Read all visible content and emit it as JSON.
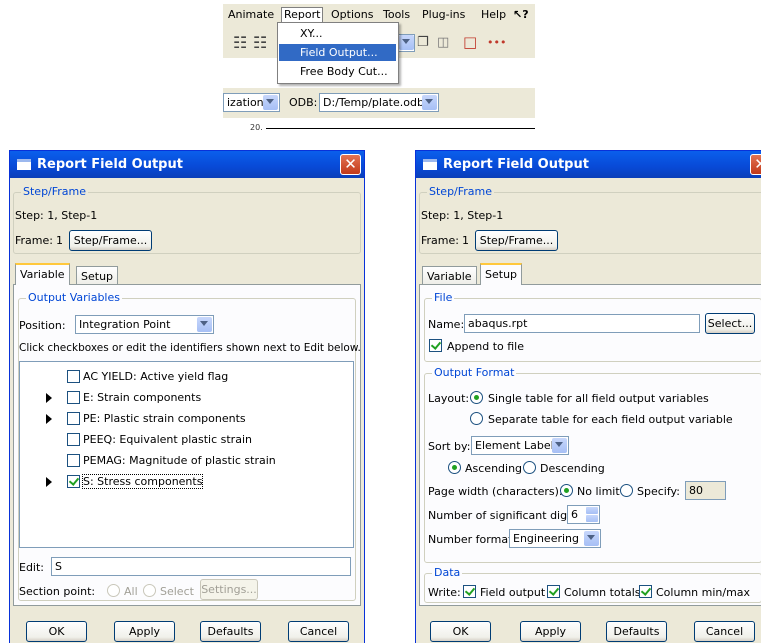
{
  "menubar": {
    "items": [
      "Animate",
      "Report",
      "Options",
      "Tools",
      "Plug-ins",
      "Help",
      "↖?"
    ],
    "active": "Report"
  },
  "report_menu": {
    "items": [
      "XY...",
      "Field Output...",
      "Free Body Cut..."
    ],
    "highlighted": "Field Output..."
  },
  "context_bar": {
    "module_combo_value": "ization",
    "odb_label": "ODB:",
    "odb_value": "D:/Temp/plate.odb"
  },
  "plot_tick_label": "20.",
  "colors": {
    "title_bar": "#0a5fec",
    "selection": "#316ac5",
    "group_title": "#0046d5",
    "dialog_bg": "#ece9d8"
  },
  "dialog_left": {
    "title": "Report Field Output",
    "step_frame_group": "Step/Frame",
    "step_text": "Step: 1, Step-1",
    "frame_label": "Frame:",
    "frame_value": "1",
    "step_frame_button": "Step/Frame...",
    "tabs": [
      "Variable",
      "Setup"
    ],
    "active_tab": "Variable",
    "output_variables_group": "Output Variables",
    "position_label": "Position:",
    "position_value": "Integration Point",
    "instructions": "Click checkboxes or edit the identifiers shown next to Edit below.",
    "variables": [
      {
        "label": "AC YIELD: Active yield flag",
        "checked": false,
        "expandable": false
      },
      {
        "label": "E: Strain components",
        "checked": false,
        "expandable": true
      },
      {
        "label": "PE: Plastic strain components",
        "checked": false,
        "expandable": true
      },
      {
        "label": "PEEQ: Equivalent plastic strain",
        "checked": false,
        "expandable": false
      },
      {
        "label": "PEMAG: Magnitude of plastic strain",
        "checked": false,
        "expandable": false
      },
      {
        "label": "S: Stress components",
        "checked": true,
        "expandable": true
      }
    ],
    "edit_label": "Edit:",
    "edit_value": "S",
    "section_point_label": "Section point:",
    "section_all": "All",
    "section_select": "Select",
    "settings_button": "Settings...",
    "buttons": [
      "OK",
      "Apply",
      "Defaults",
      "Cancel"
    ]
  },
  "dialog_right": {
    "title": "Report Field Output",
    "step_frame_group": "Step/Frame",
    "step_text": "Step: 1, Step-1",
    "frame_label": "Frame:",
    "frame_value": "1",
    "step_frame_button": "Step/Frame...",
    "tabs": [
      "Variable",
      "Setup"
    ],
    "active_tab": "Setup",
    "file_group": "File",
    "name_label": "Name:",
    "name_value": "abaqus.rpt",
    "select_button": "Select...",
    "append_label": "Append to file",
    "append_checked": true,
    "output_format_group": "Output Format",
    "layout_label": "Layout:",
    "layout_single": "Single table for all field output variables",
    "layout_separate": "Separate table for each field output variable",
    "layout_selected": "single",
    "sort_by_label": "Sort by:",
    "sort_by_value": "Element Label",
    "ascending": "Ascending",
    "descending": "Descending",
    "order_selected": "ascending",
    "page_width_label": "Page width (characters):",
    "no_limit": "No limit",
    "specify": "Specify:",
    "page_width_selected": "no_limit",
    "specify_value": "80",
    "sig_digits_label": "Number of significant digits:",
    "sig_digits_value": "6",
    "number_format_label": "Number format:",
    "number_format_value": "Engineering",
    "data_group": "Data",
    "write_label": "Write:",
    "write_field_output": "Field output",
    "write_column_totals": "Column totals",
    "write_column_minmax": "Column min/max",
    "buttons": [
      "OK",
      "Apply",
      "Defaults",
      "Cancel"
    ]
  }
}
